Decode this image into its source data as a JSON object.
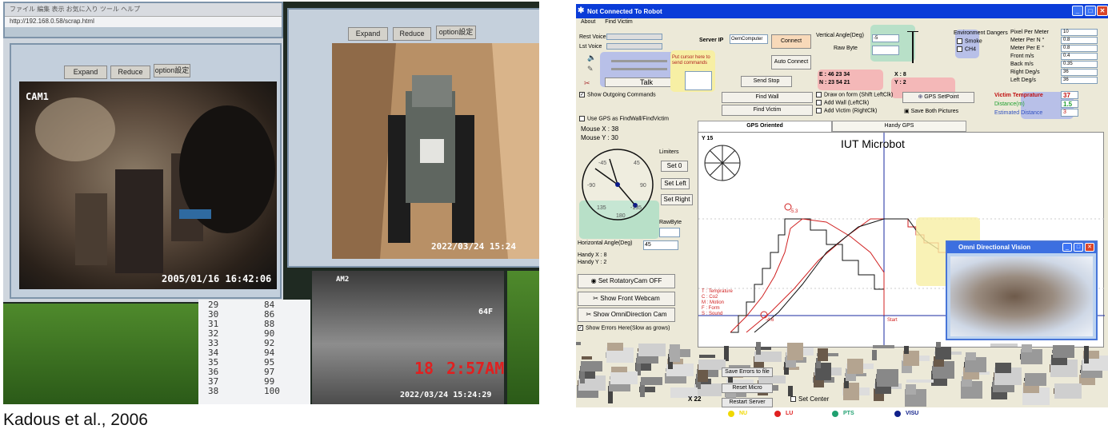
{
  "left_photo": {
    "browser_menu": "ファイル  編集  表示  お気に入り  ツール  ヘルプ",
    "address": "http://192.168.0.58/scrap.html",
    "cam1": {
      "buttons": [
        "Expand",
        "Reduce",
        "option設定"
      ],
      "label": "CAM1",
      "timestamp": "2005/01/16  16:42:06"
    },
    "cam2": {
      "buttons": [
        "Expand",
        "Reduce",
        "option設定"
      ],
      "timestamp": "2022/03/24  15:24"
    },
    "cam3": {
      "label": "AM2",
      "big_time_a": "18",
      "big_time_b": "2:57AM",
      "side_label": "64F",
      "timestamp": "2022/03/24  15:24:29"
    },
    "table_rows": [
      [
        "29",
        "84"
      ],
      [
        "30",
        "86"
      ],
      [
        "31",
        "88"
      ],
      [
        "32",
        "90"
      ],
      [
        "33",
        "92"
      ],
      [
        "34",
        "94"
      ],
      [
        "35",
        "95"
      ],
      [
        "36",
        "97"
      ],
      [
        "37",
        "99"
      ],
      [
        "38",
        "100"
      ]
    ],
    "caption": "Kadous et al., 2006"
  },
  "app": {
    "title": "Not Connected To Robot",
    "menu": [
      "About",
      "Find Victim"
    ],
    "rest_voice": "Rest Voice",
    "lst_voice": "Lst Voice",
    "talk": "Talk",
    "put_cursor_hint": "Put cursor here to send commands",
    "server_ip_label": "Server IP",
    "server_ip_value": "OemComputer",
    "connect": "Connect",
    "auto_connect": "Auto Connect",
    "send_stop": "Send Stop",
    "show_outgoing": "Show Outgoing Commands",
    "find_wall": "Find Wall",
    "find_victim": "Find Victim",
    "vertical_angle_label": "Vertical Angle(Deg)",
    "vertical_angle_value": "-5",
    "raw_byte_label": "Raw Byte",
    "e_label": "E : 46 23 34",
    "n_label": "N : 23 54 21",
    "x_label": "X : 8",
    "y_label": "Y : 2",
    "draw_form": "Draw on form (Shift LeftClk)",
    "add_wall": "Add Wall  (LeftClk)",
    "add_victim": "Add Victim (RightClk)",
    "gps_setpoint": "GPS SetPoint",
    "save_both": "Save Both Pictures",
    "env_dangers": "Environment Dangers",
    "smoke": "Smoke",
    "ch4": "CH4",
    "params": [
      {
        "label": "Pixel Per Meter",
        "value": "10"
      },
      {
        "label": "Meter Per N °",
        "value": "0.8"
      },
      {
        "label": "Meter Per E °",
        "value": "0.8"
      },
      {
        "label": "Front m/s",
        "value": "0.4"
      },
      {
        "label": "Back m/s",
        "value": "0.35"
      },
      {
        "label": "Right Deg/s",
        "value": "36"
      },
      {
        "label": "Left  Deg/s",
        "value": "36"
      }
    ],
    "victim_temp_label": "Victim Temprature",
    "victim_temp_value": "37",
    "distance_label": "Distance(m)",
    "distance_value": "1.5",
    "est_distance_label": "Estimated Distance",
    "est_distance_value": "3",
    "use_gps": "Use GPS as FindWall/FindVictim",
    "mouse_x": "Mouse X :   38",
    "mouse_y": "Mouse Y :   30",
    "limiters": "Limiters",
    "set0": "Set 0",
    "set_left": "Set Left",
    "set_right": "Set Right",
    "rawbyte": "RawByte",
    "gauge_ticks": [
      "-45",
      "45",
      "-90",
      "90",
      "135",
      "-135",
      "180"
    ],
    "horizontal_angle_label": "Horizontal Angle(Deg)",
    "horizontal_angle_value": "45",
    "handy_x": "Handy X : 8",
    "handy_y": "Handy Y : 2",
    "set_rotatory": "Set RotatoryCam OFF",
    "show_front": "Show Front Webcam",
    "show_omni": "Show OmniDirection Cam",
    "show_errors": "Show Errors Here(Slow as grows)",
    "tab_gps": "GPS Oriented",
    "tab_handy": "Handy GPS",
    "plot_title": "IUT Microbot",
    "y_axis_label": "Y 15",
    "start_label": "Start",
    "marker_label": "-4.6",
    "top_marker_label": "-5.3",
    "legend_lines": [
      "T : Temprature",
      "C : Co2",
      "M : Motion",
      "F : Form",
      "S : Sound"
    ],
    "omni_title": "Omni Directional Vision",
    "save_errors": "Save Errors to file",
    "reset_micro": "Reset Micro",
    "restart_server": "Restart Server",
    "set_center": "Set Center",
    "x22": "X 22",
    "legend_bottom": [
      {
        "label": "NU",
        "color": "#f0d800"
      },
      {
        "label": "LU",
        "color": "#e02020"
      },
      {
        "label": "PTS",
        "color": "#20a070"
      },
      {
        "label": "VISU",
        "color": "#10208a"
      }
    ]
  }
}
